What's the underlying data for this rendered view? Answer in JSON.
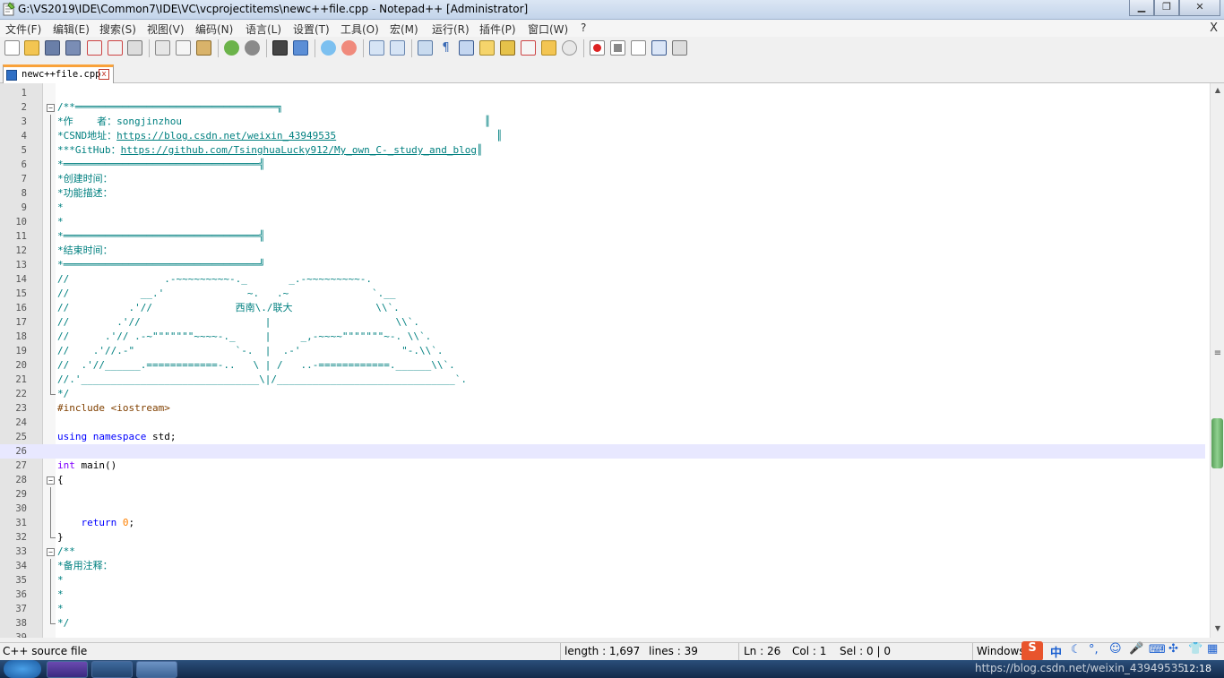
{
  "window": {
    "title": "G:\\VS2019\\IDE\\Common7\\IDE\\VC\\vcprojectitems\\newc++file.cpp - Notepad++ [Administrator]",
    "minimize": "▁",
    "maximize": "❐",
    "close": "✕"
  },
  "menu": {
    "items": [
      "文件(F)",
      "编辑(E)",
      "搜索(S)",
      "视图(V)",
      "编码(N)",
      "语言(L)",
      "设置(T)",
      "工具(O)",
      "宏(M)",
      "运行(R)",
      "插件(P)",
      "窗口(W)",
      "?"
    ],
    "close": "X"
  },
  "tab": {
    "label": "newc++file.cpp",
    "close": "x"
  },
  "editor": {
    "current_line": 26,
    "lines": [
      "",
      "/**══════════════════════════════════╗",
      "*作    者：songjinzhou                                                   ║",
      "*CSND地址：https://blog.csdn.net/weixin_43949535                           ║",
      "***GitHub：https://github.com/TsinghuaLucky912/My_own_C-_study_and_blog║",
      "*═════════════════════════════════╣",
      "*创建时间：",
      "*功能描述：",
      "*",
      "*",
      "*═════════════════════════════════╣",
      "*结束时间：",
      "*═════════════════════════════════╝",
      "//                .-~~~~~~~~~-._       _.-~~~~~~~~~-.",
      "//            __.'              ~.   .~              `.__",
      "//          .'//              西南\\./联大              \\\\`.",
      "//        .'//                     |                     \\\\`.",
      "//      .'// .-~\"\"\"\"\"\"\"~~~~-._     |     _,-~~~~\"\"\"\"\"\"\"~-. \\\\`.",
      "//    .'//.-\"                 `-.  |  .-'                 \"-.\\\\`.",
      "//  .'//______.============-..   \\ | /   ..-============.______\\\\`.",
      "//.'______________________________\\|/______________________________`.",
      "*/",
      "#include <iostream>",
      "",
      "using namespace std;",
      "",
      "int main()",
      "{",
      "",
      "",
      "    return 0;",
      "}",
      "/**",
      "*备用注释：",
      "*",
      "*",
      "*",
      "*/",
      ""
    ]
  },
  "status": {
    "filetype": "C++ source file",
    "length": "length : 1,697",
    "lines": "lines : 39",
    "ln": "Ln : 26",
    "col": "Col : 1",
    "sel": "Sel : 0 | 0",
    "eol": "Windows"
  },
  "ime": {
    "lang": "中",
    "watermark": "https://blog.csdn.net/weixin_43949535"
  },
  "taskbar": {
    "time": "12:18"
  }
}
